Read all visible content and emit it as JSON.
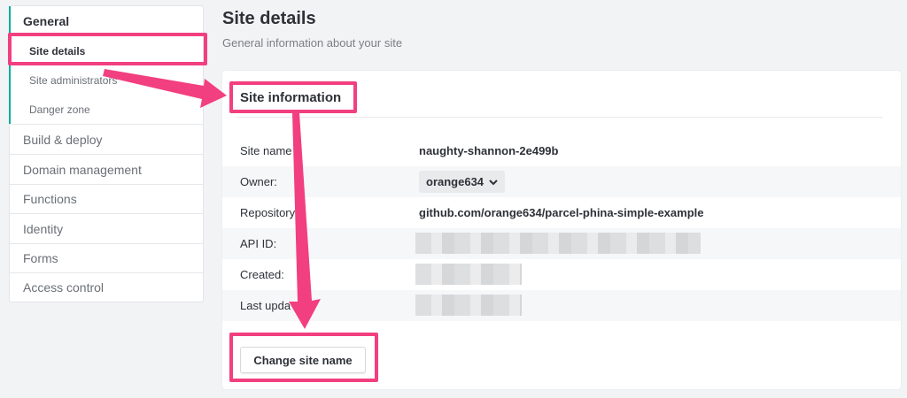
{
  "sidebar": {
    "general": "General",
    "sub_items": [
      "Site details",
      "Site administrators",
      "Danger zone"
    ],
    "items": [
      "Build & deploy",
      "Domain management",
      "Functions",
      "Identity",
      "Forms",
      "Access control"
    ]
  },
  "header": {
    "title": "Site details",
    "subtitle": "General information about your site"
  },
  "card": {
    "title": "Site information",
    "rows": [
      {
        "label": "Site name",
        "value": "naughty-shannon-2e499b"
      },
      {
        "label": "Owner:",
        "value": "orange634"
      },
      {
        "label": "Repository",
        "value": "github.com/orange634/parcel-phina-simple-example"
      },
      {
        "label": "API ID:",
        "value": ""
      },
      {
        "label": "Created:",
        "value": ""
      },
      {
        "label": "Last upda",
        "value": ""
      }
    ],
    "button": "Change site name"
  },
  "colors": {
    "accent": "#00ad9f",
    "annotation": "#f23f7f"
  }
}
